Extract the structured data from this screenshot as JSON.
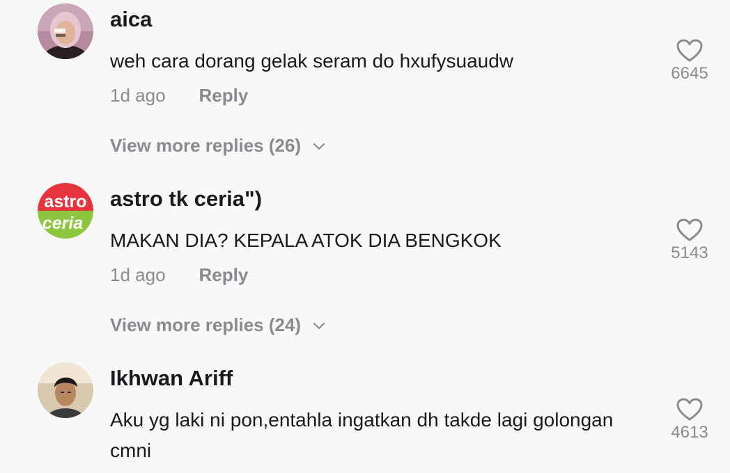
{
  "comments": [
    {
      "username": "aica",
      "text": "weh cara dorang gelak seram do hxufysuaudw",
      "time": "1d ago",
      "reply_label": "Reply",
      "view_more": "View more replies (26)",
      "likes": "6645",
      "avatar_icon": "person-hijab-avatar"
    },
    {
      "username": "astro tk ceria\")",
      "text": "MAKAN DIA? KEPALA ATOK DIA BENGKOK",
      "time": "1d ago",
      "reply_label": "Reply",
      "view_more": "View more replies (24)",
      "likes": "5143",
      "avatar_logo": {
        "line1": "astro",
        "line2": "ceria",
        "top_color": "#e5343d",
        "bottom_color": "#8cc63f"
      }
    },
    {
      "username": "Ikhwan Ariff",
      "text": "Aku yg laki ni pon,entahla ingatkan dh takde lagi golongan cmni",
      "likes": "4613",
      "avatar_icon": "person-photo-avatar"
    }
  ],
  "colors": {
    "background": "#f8f8f8",
    "primary_text": "#1a1a1e",
    "secondary_text": "#8a8b91"
  }
}
